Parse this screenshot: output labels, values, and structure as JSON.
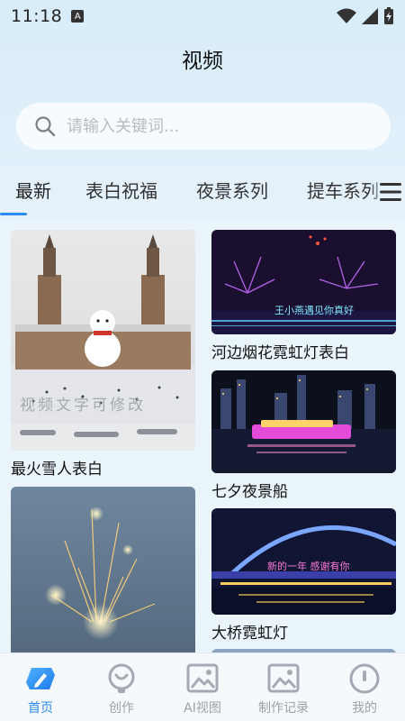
{
  "status": {
    "time": "11:18",
    "indicator": "A"
  },
  "header": {
    "title": "视频"
  },
  "search": {
    "placeholder": "请输入关键词..."
  },
  "tabs": [
    {
      "label": "最新",
      "active": true
    },
    {
      "label": "表白祝福"
    },
    {
      "label": "夜景系列"
    },
    {
      "label": "提车系列"
    }
  ],
  "cards": {
    "left": [
      {
        "label": "最火雪人表白",
        "watermark": "视频文字可修改"
      },
      {
        "label": ""
      }
    ],
    "right": [
      {
        "label": "河边烟花霓虹灯表白",
        "overlay": "王小燕遇见你真好"
      },
      {
        "label": "七夕夜景船"
      },
      {
        "label": "大桥霓虹灯",
        "overlay": "新的一年 感谢有你"
      }
    ]
  },
  "nav": [
    {
      "label": "首页",
      "icon": "pencil-icon",
      "active": true
    },
    {
      "label": "创作",
      "icon": "create-icon"
    },
    {
      "label": "AI视图",
      "icon": "image-icon"
    },
    {
      "label": "制作记录",
      "icon": "record-icon"
    },
    {
      "label": "我的",
      "icon": "profile-icon"
    }
  ],
  "colors": {
    "accent": "#2a8cf0",
    "background": "#eaf4fb"
  }
}
